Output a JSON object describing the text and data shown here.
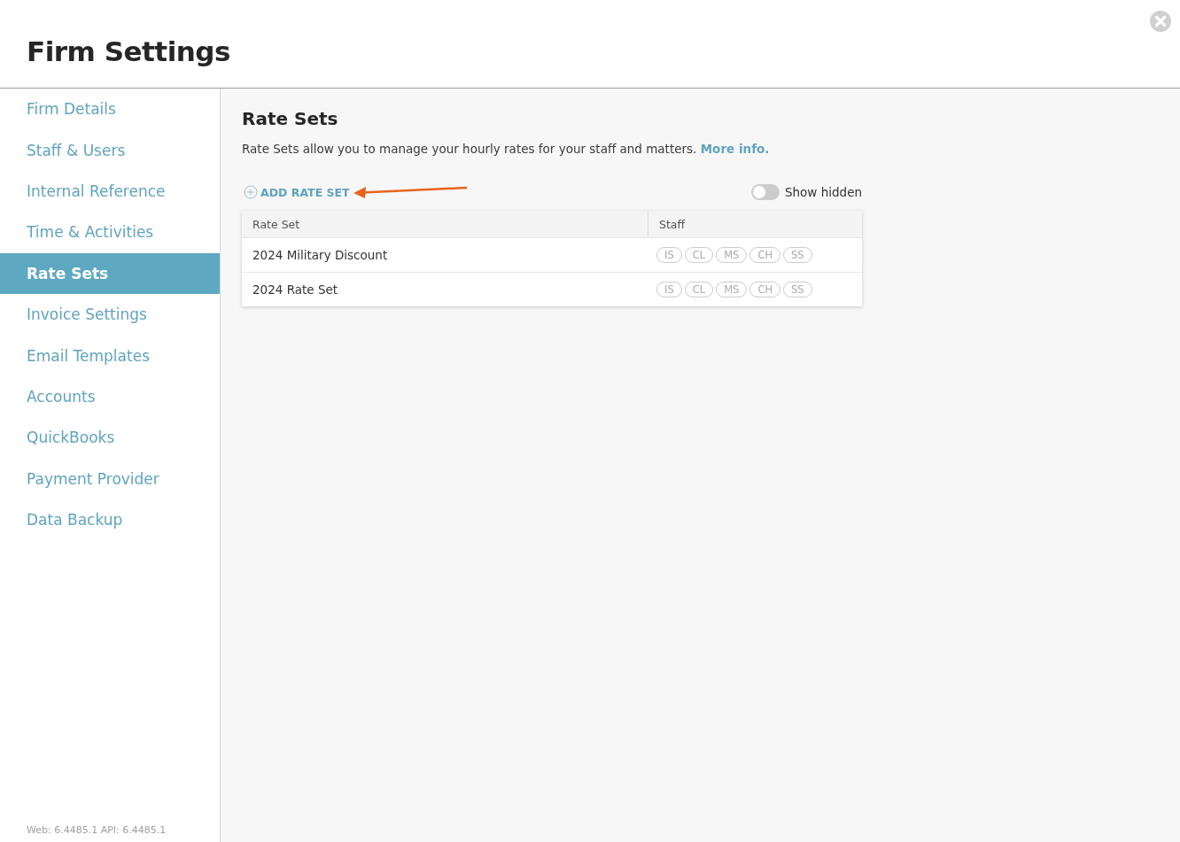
{
  "window": {
    "title": "Firm Settings"
  },
  "sidebar": {
    "items": [
      {
        "label": "Firm Details",
        "selected": false
      },
      {
        "label": "Staff & Users",
        "selected": false
      },
      {
        "label": "Internal Reference",
        "selected": false
      },
      {
        "label": "Time & Activities",
        "selected": false
      },
      {
        "label": "Rate Sets",
        "selected": true
      },
      {
        "label": "Invoice Settings",
        "selected": false
      },
      {
        "label": "Email Templates",
        "selected": false
      },
      {
        "label": "Accounts",
        "selected": false
      },
      {
        "label": "QuickBooks",
        "selected": false
      },
      {
        "label": "Payment Provider",
        "selected": false
      },
      {
        "label": "Data Backup",
        "selected": false
      }
    ],
    "version": "Web: 6.4485.1 API: 6.4485.1"
  },
  "content": {
    "title": "Rate Sets",
    "description": "Rate Sets allow you to manage your hourly rates for your staff and matters.",
    "link": "More info.",
    "add_button": "ADD RATE SET",
    "show_hidden": {
      "label": "Show hidden",
      "on": false
    },
    "table": {
      "columns": [
        "Rate Set",
        "Staff"
      ],
      "rows": [
        {
          "name": "2024 Military Discount",
          "staff": [
            "IS",
            "CL",
            "MS",
            "CH",
            "SS"
          ]
        },
        {
          "name": "2024 Rate Set",
          "staff": [
            "IS",
            "CL",
            "MS",
            "CH",
            "SS"
          ]
        }
      ]
    }
  }
}
